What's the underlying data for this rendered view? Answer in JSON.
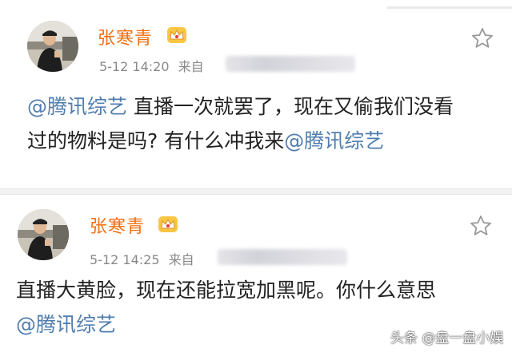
{
  "posts": [
    {
      "user": "张寒青",
      "time": "5-12 14:20",
      "source_label": "来自",
      "line1_mention": "@腾讯综艺",
      "line1_text": " 直播一次就罢了，现在又偷我们没看",
      "line2_text": "过的物料是吗? 有什么冲我来",
      "line2_mention": "@腾讯综艺"
    },
    {
      "user": "张寒青",
      "time": "5-12 14:25",
      "source_label": "来自",
      "line1_text": "直播大黄脸，现在还能拉宽加黑呢。你什么意思",
      "line2_mention": "@腾讯综艺"
    }
  ],
  "watermark": "头条 @盘一盘小娱",
  "colors": {
    "username": "#f36f10",
    "mention": "#507daf",
    "meta": "#888888",
    "body_text": "#222222"
  },
  "icons": {
    "verified_badge": "crown-badge-icon",
    "favorite": "star-icon"
  }
}
